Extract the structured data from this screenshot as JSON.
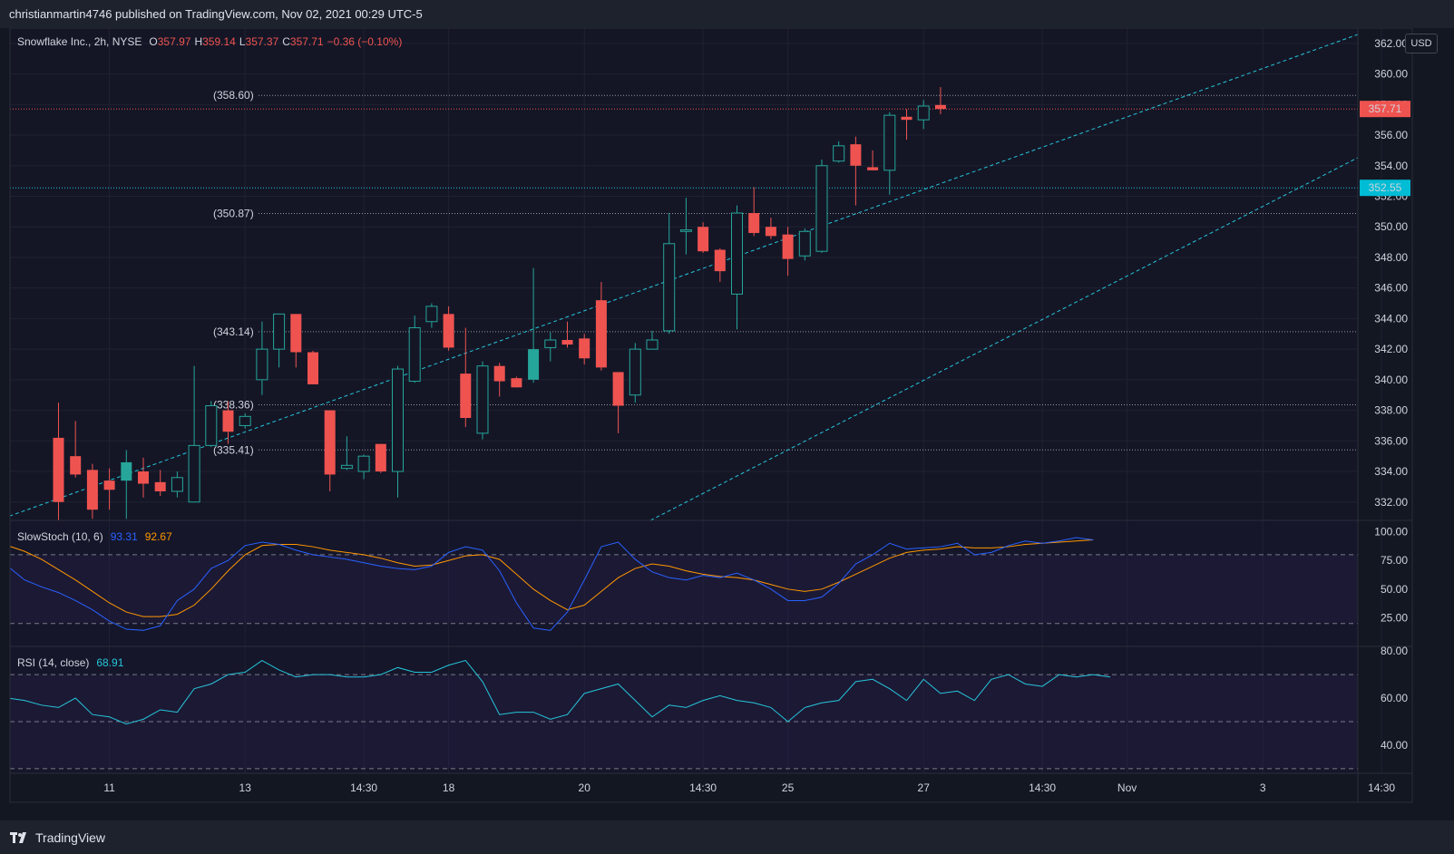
{
  "header": {
    "publisher_line": "christianmartin4746 published on TradingView.com, Nov 02, 2021 00:29 UTC-5"
  },
  "symbol": {
    "name": "Snowflake Inc., 2h, NYSE",
    "open_label": "O",
    "open": "357.97",
    "high_label": "H",
    "high": "359.14",
    "low_label": "L",
    "low": "357.37",
    "close_label": "C",
    "close": "357.71",
    "change": "−0.36 (−0.10%)"
  },
  "currency": "USD",
  "price_badges": {
    "last": "357.71",
    "level": "352.55"
  },
  "slowstoch": {
    "label": "SlowStoch (10, 6)",
    "k_value": "93.31",
    "d_value": "92.67"
  },
  "rsi": {
    "label": "RSI (14, close)",
    "value": "68.91"
  },
  "footer": {
    "brand": "TradingView"
  },
  "colors": {
    "up": "#26a69a",
    "down": "#ef5350",
    "channel": "#26c6da",
    "stoch_k": "#2962ff",
    "stoch_d": "#ff9800",
    "rsi": "#26c6da",
    "background": "#131722"
  },
  "chart_data": [
    {
      "type": "candlestick",
      "title": "Snowflake Inc., 2h, NYSE",
      "ylim": [
        330.8,
        363.0
      ],
      "y_ticks": [
        332,
        334,
        336,
        338,
        340,
        342,
        344,
        346,
        348,
        350,
        352,
        354,
        356,
        358,
        360,
        362
      ],
      "x_ticks": [
        {
          "label": "11",
          "bar": 3
        },
        {
          "label": "13",
          "bar": 11
        },
        {
          "label": "14:30",
          "bar": 18
        },
        {
          "label": "18",
          "bar": 23
        },
        {
          "label": "20",
          "bar": 31
        },
        {
          "label": "14:30",
          "bar": 38
        },
        {
          "label": "25",
          "bar": 43
        },
        {
          "label": "27",
          "bar": 51
        },
        {
          "label": "14:30",
          "bar": 58
        },
        {
          "label": "Nov",
          "bar": 63
        },
        {
          "label": "3",
          "bar": 71
        },
        {
          "label": "14:30",
          "bar": 78
        }
      ],
      "candles": [
        [
          336.2,
          338.5,
          330.8,
          332.0
        ],
        [
          335.0,
          337.3,
          333.6,
          333.8
        ],
        [
          334.1,
          334.5,
          330.9,
          331.5
        ],
        [
          333.4,
          334.2,
          331.5,
          332.8
        ],
        [
          333.4,
          335.4,
          330.9,
          334.6
        ],
        [
          334.0,
          334.9,
          332.3,
          333.2
        ],
        [
          333.3,
          334.1,
          332.4,
          332.7
        ],
        [
          332.7,
          334.0,
          332.3,
          333.6
        ],
        [
          332.0,
          340.9,
          332.0,
          335.7
        ],
        [
          335.7,
          338.6,
          335.6,
          338.3
        ],
        [
          338.0,
          338.6,
          335.8,
          336.6
        ],
        [
          337.0,
          337.8,
          336.8,
          337.6
        ],
        [
          340.0,
          343.8,
          339.0,
          342.0
        ],
        [
          342.0,
          344.3,
          340.8,
          344.3
        ],
        [
          344.3,
          344.3,
          340.8,
          341.8
        ],
        [
          341.8,
          341.9,
          339.7,
          339.7
        ],
        [
          338.0,
          338.0,
          332.7,
          333.8
        ],
        [
          334.2,
          336.3,
          334.1,
          334.4
        ],
        [
          334.0,
          335.1,
          333.5,
          335.0
        ],
        [
          335.8,
          335.8,
          333.9,
          334.0
        ],
        [
          334.0,
          340.9,
          332.3,
          340.7
        ],
        [
          339.9,
          344.2,
          339.8,
          343.4
        ],
        [
          343.8,
          345.0,
          343.4,
          344.8
        ],
        [
          344.3,
          344.8,
          341.9,
          342.1
        ],
        [
          340.4,
          343.4,
          336.9,
          337.5
        ],
        [
          336.5,
          341.2,
          336.1,
          340.9
        ],
        [
          340.9,
          341.1,
          338.9,
          339.9
        ],
        [
          340.1,
          340.2,
          339.5,
          339.5
        ],
        [
          340.0,
          347.3,
          339.8,
          342.0
        ],
        [
          342.1,
          343.1,
          341.2,
          342.6
        ],
        [
          342.6,
          343.8,
          342.1,
          342.3
        ],
        [
          342.7,
          343.0,
          341.0,
          341.4
        ],
        [
          345.2,
          346.4,
          340.6,
          340.8
        ],
        [
          340.5,
          340.5,
          336.5,
          338.3
        ],
        [
          339.0,
          342.4,
          338.5,
          342.0
        ],
        [
          342.0,
          343.2,
          342.0,
          342.6
        ],
        [
          343.2,
          350.9,
          343.0,
          348.9
        ],
        [
          349.7,
          351.9,
          348.2,
          349.8
        ],
        [
          350.0,
          350.3,
          348.3,
          348.4
        ],
        [
          348.5,
          348.6,
          346.4,
          347.1
        ],
        [
          345.6,
          351.4,
          343.3,
          350.9
        ],
        [
          350.9,
          352.6,
          349.4,
          349.6
        ],
        [
          350.0,
          350.6,
          349.2,
          349.4
        ],
        [
          349.5,
          350.0,
          346.8,
          347.9
        ],
        [
          348.1,
          349.9,
          347.8,
          349.7
        ],
        [
          348.4,
          354.4,
          348.3,
          354.0
        ],
        [
          354.3,
          355.6,
          354.2,
          355.3
        ],
        [
          355.4,
          355.9,
          351.4,
          354.0
        ],
        [
          353.9,
          355.0,
          353.7,
          353.7
        ],
        [
          353.7,
          357.5,
          352.1,
          357.3
        ],
        [
          357.2,
          357.7,
          355.7,
          357.0
        ],
        [
          357.0,
          358.3,
          356.4,
          357.9
        ],
        [
          357.97,
          359.14,
          357.37,
          357.71
        ]
      ],
      "horizontal_levels": [
        {
          "label": "(358.60)",
          "value": 358.6
        },
        {
          "label": "(350.87)",
          "value": 350.87
        },
        {
          "label": "(343.14)",
          "value": 343.14
        },
        {
          "label": "(338.36)",
          "value": 338.36
        },
        {
          "label": "(335.41)",
          "value": 335.41
        }
      ],
      "price_lines": [
        {
          "label": "357.71",
          "value": 357.71
        },
        {
          "label": "352.55",
          "value": 352.55
        }
      ],
      "channel_lines": [
        {
          "from": {
            "bar": -3.6,
            "price": 330.8
          },
          "to": {
            "bar": 82.2,
            "price": 364.8
          }
        },
        {
          "from": {
            "bar": 34.9,
            "price": 330.8
          },
          "to": {
            "bar": 91.5,
            "price": 363.0
          }
        }
      ]
    },
    {
      "type": "line",
      "title": "SlowStoch (10, 6)",
      "ylim": [
        0,
        110
      ],
      "y_ticks": [
        25,
        50,
        75,
        100
      ],
      "bands": [
        20,
        80
      ],
      "series": [
        {
          "name": "%K",
          "values": [
            70,
            58,
            52,
            47,
            40,
            32,
            22,
            15,
            14,
            18,
            40,
            50,
            68,
            75,
            88,
            91,
            89,
            84,
            80,
            78,
            76,
            73,
            70,
            68,
            67,
            70,
            82,
            87,
            84,
            66,
            38,
            16,
            14,
            30,
            58,
            87,
            91,
            76,
            65,
            60,
            58,
            62,
            60,
            64,
            58,
            50,
            40,
            40,
            43,
            55,
            72,
            80,
            90,
            85,
            86,
            87,
            90,
            80,
            82,
            88,
            92,
            90,
            92,
            95,
            93
          ]
        },
        {
          "name": "%D",
          "values": [
            88,
            83,
            76,
            67,
            58,
            48,
            38,
            30,
            26,
            26,
            28,
            36,
            50,
            66,
            80,
            88,
            89,
            89,
            87,
            84,
            82,
            80,
            77,
            73,
            70,
            71,
            75,
            79,
            80,
            76,
            63,
            50,
            40,
            32,
            36,
            48,
            60,
            68,
            72,
            70,
            66,
            63,
            61,
            60,
            58,
            54,
            50,
            48,
            50,
            56,
            63,
            70,
            77,
            82,
            84,
            85,
            87,
            86,
            86,
            87,
            89,
            90,
            91,
            92,
            93
          ]
        }
      ]
    },
    {
      "type": "line",
      "title": "RSI (14, close)",
      "ylim": [
        28,
        82
      ],
      "y_ticks": [
        40,
        60,
        80
      ],
      "bands": [
        30,
        50,
        70
      ],
      "series": [
        {
          "name": "RSI",
          "values": [
            60,
            59,
            57,
            56,
            60,
            53,
            52,
            49,
            51,
            55,
            54,
            64,
            66,
            70,
            71,
            76,
            72,
            69,
            70,
            70,
            69,
            69,
            70,
            73,
            71,
            71,
            74,
            76,
            67,
            53,
            54,
            54,
            51,
            53,
            62,
            64,
            66,
            59,
            52,
            57,
            56,
            59,
            61,
            59,
            58,
            56,
            50,
            56,
            58,
            59,
            67,
            68,
            64,
            59,
            68,
            62,
            63,
            59,
            68,
            70,
            66,
            65,
            70,
            69,
            70,
            69
          ]
        }
      ]
    }
  ]
}
